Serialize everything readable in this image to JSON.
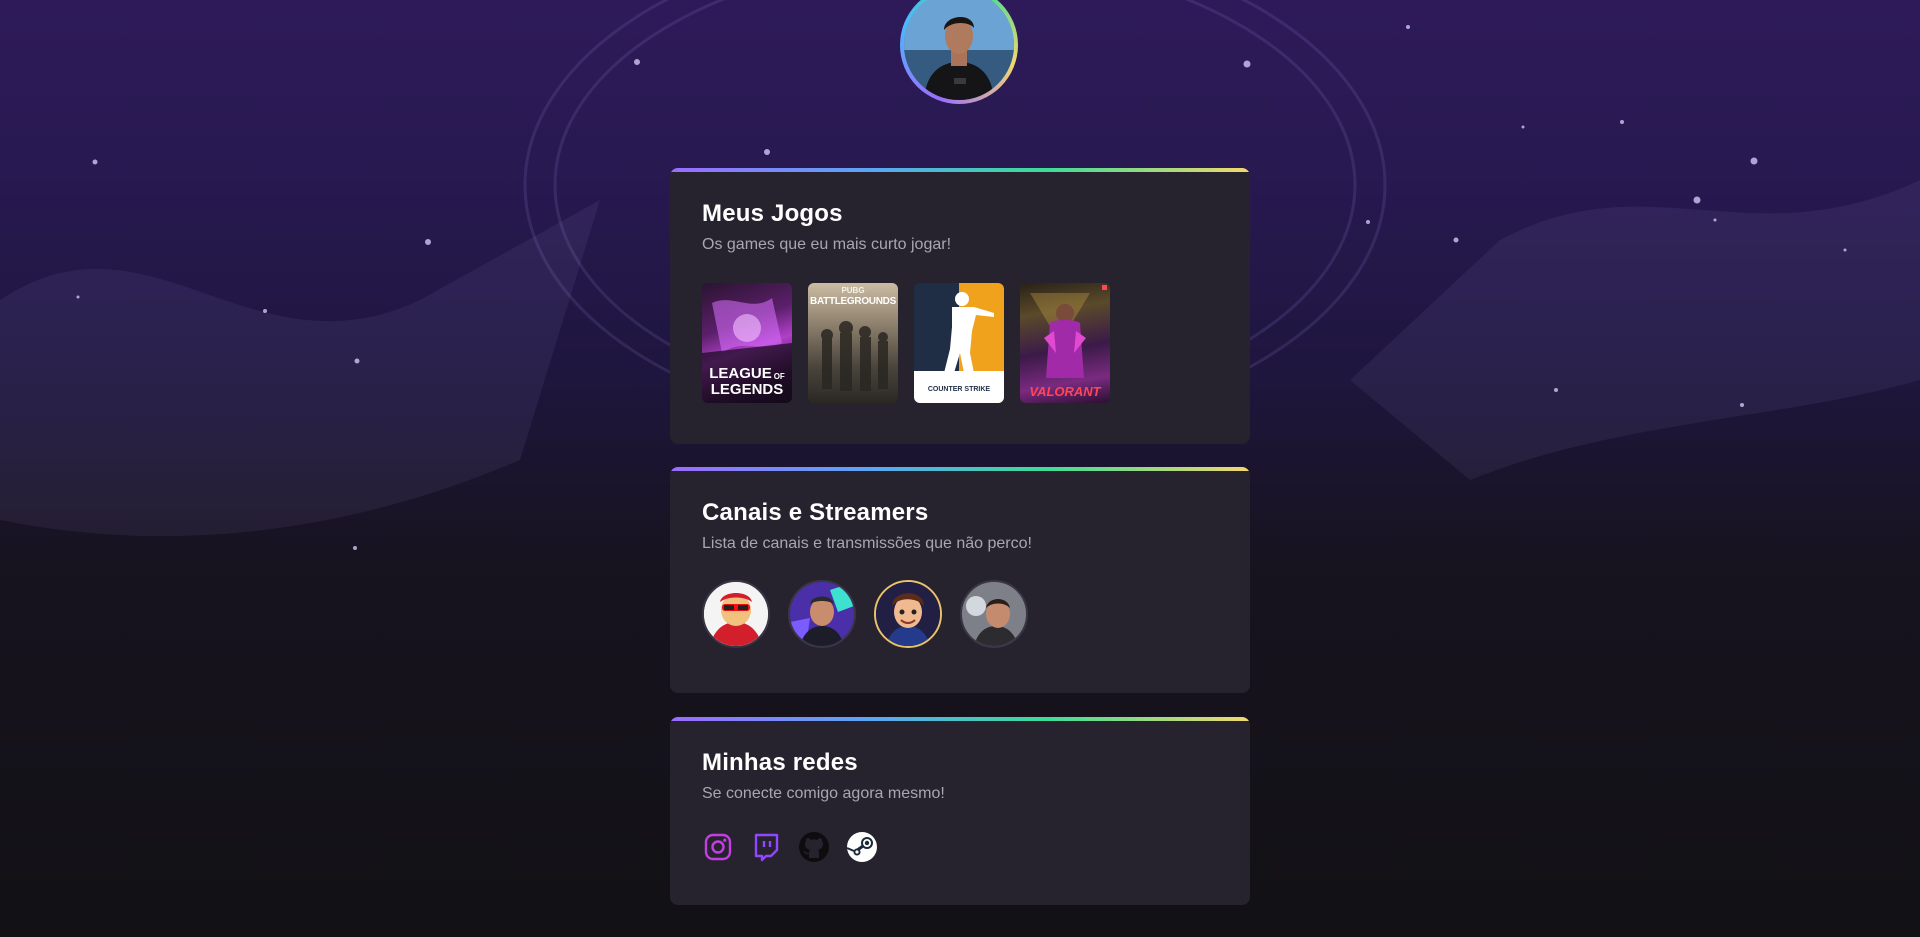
{
  "profile": {
    "avatar_alt": "Foto de perfil"
  },
  "colors": {
    "card_bg": "#26232f",
    "accent_gradient": [
      "#9b6cff",
      "#5aa6f5",
      "#3ddc97",
      "#f5d76e"
    ],
    "instagram": "#c43fe3",
    "twitch": "#9146ff"
  },
  "sections": {
    "games": {
      "title": "Meus Jogos",
      "subtitle": "Os games que eu mais curto jogar!",
      "items": [
        {
          "name": "League of Legends",
          "label_line1": "LEAGUE",
          "label_line2": "LEGENDS",
          "label_of": "OF",
          "icon": "league-of-legends-cover"
        },
        {
          "name": "PUBG Battlegrounds",
          "label_top": "PUBG",
          "label_main": "BATTLEGROUNDS",
          "icon": "pubg-cover"
        },
        {
          "name": "Counter-Strike",
          "label": "COUNTER STRIKE",
          "icon": "counter-strike-cover"
        },
        {
          "name": "Valorant",
          "label": "VALORANT",
          "icon": "valorant-cover"
        }
      ]
    },
    "streamers": {
      "title": "Canais e Streamers",
      "subtitle": "Lista de canais e transmissões que não perco!",
      "items": [
        {
          "icon": "streamer-avatar-1"
        },
        {
          "icon": "streamer-avatar-2"
        },
        {
          "icon": "streamer-avatar-3"
        },
        {
          "icon": "streamer-avatar-4"
        }
      ]
    },
    "socials": {
      "title": "Minhas redes",
      "subtitle": "Se conecte comigo agora mesmo!",
      "items": [
        {
          "name": "Instagram",
          "icon": "instagram-icon"
        },
        {
          "name": "Twitch",
          "icon": "twitch-icon"
        },
        {
          "name": "GitHub",
          "icon": "github-icon"
        },
        {
          "name": "Steam",
          "icon": "steam-icon"
        }
      ]
    }
  }
}
